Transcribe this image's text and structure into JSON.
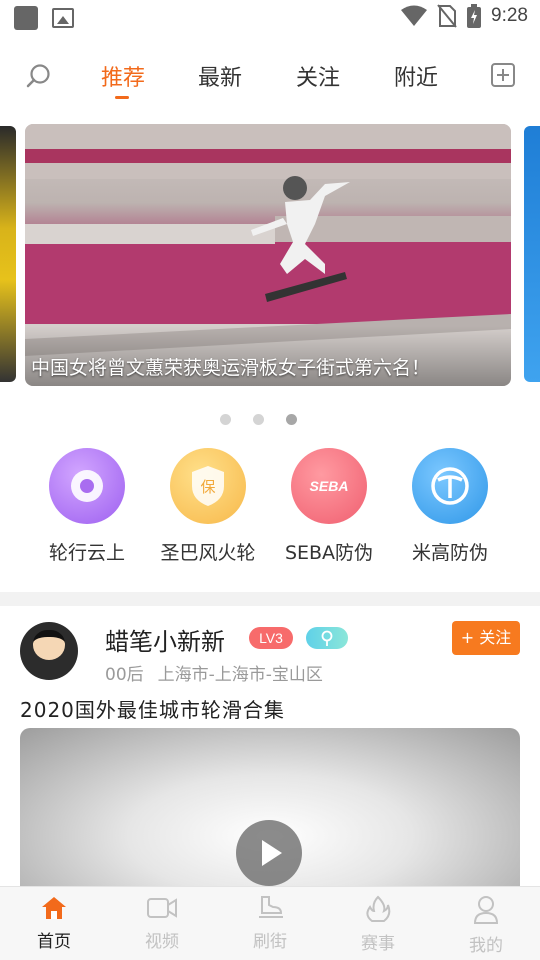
{
  "status_bar": {
    "time": "9:28"
  },
  "top_nav": {
    "tabs": [
      {
        "label": "推荐",
        "active": true
      },
      {
        "label": "最新",
        "active": false
      },
      {
        "label": "关注",
        "active": false
      },
      {
        "label": "附近",
        "active": false
      }
    ]
  },
  "banner": {
    "caption": "中国女将曾文蕙荣获奥运滑板女子街式第六名！",
    "page_count": 3,
    "active_page": 3
  },
  "shortcuts": [
    {
      "label": "轮行云上",
      "icon": "ball-icon",
      "color": "#a96df0"
    },
    {
      "label": "圣巴风火轮",
      "icon": "shield-icon",
      "color": "#f9c35a"
    },
    {
      "label": "SEBA防伪",
      "icon": "seba-logo-icon",
      "color": "#f4727f"
    },
    {
      "label": "米高防伪",
      "icon": "micro-logo-icon",
      "color": "#3ea6ee"
    }
  ],
  "post": {
    "username": "蜡笔小新新",
    "level": "LV3",
    "follow_label": "+ 关注",
    "age_group": "00后",
    "location": "上海市-上海市-宝山区",
    "title": "2020国外最佳城市轮滑合集"
  },
  "bottom_nav": [
    {
      "label": "首页",
      "icon": "home-icon",
      "active": true
    },
    {
      "label": "视频",
      "icon": "video-icon",
      "active": false
    },
    {
      "label": "刷街",
      "icon": "skate-icon",
      "active": false
    },
    {
      "label": "赛事",
      "icon": "flame-icon",
      "active": false
    },
    {
      "label": "我的",
      "icon": "user-icon",
      "active": false
    }
  ],
  "colors": {
    "accent": "#f26a1b",
    "follow": "#f77a1f"
  }
}
